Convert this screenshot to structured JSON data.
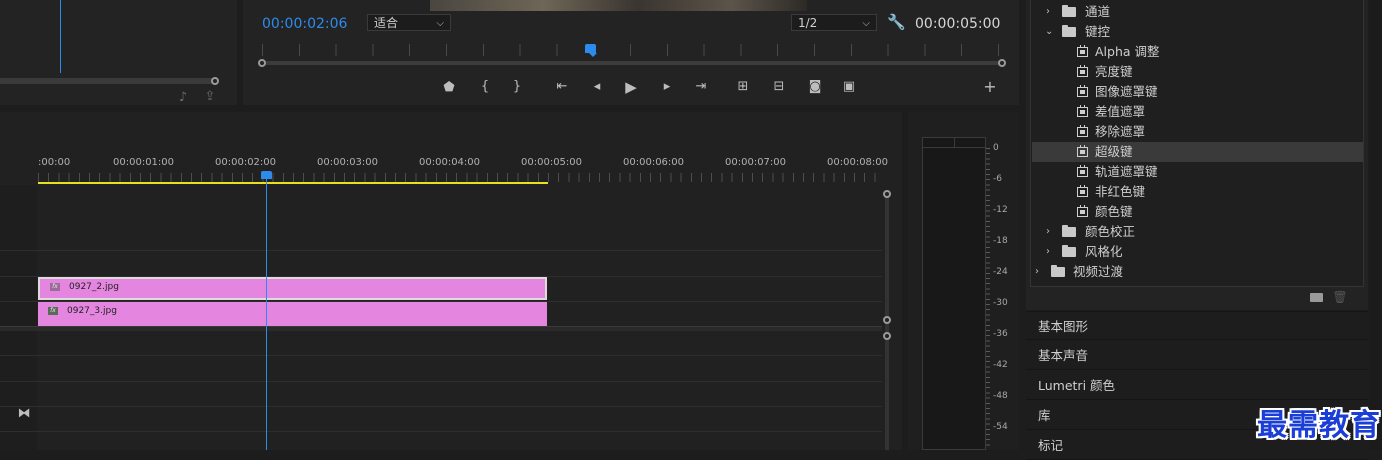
{
  "program_monitor": {
    "current_timecode": "00:00:02:06",
    "fit_select": "适合",
    "resolution_select": "1/2",
    "duration_timecode": "00:00:05:00"
  },
  "timeline": {
    "ruler_labels": [
      ":00:00",
      "00:00:01:00",
      "00:00:02:00",
      "00:00:03:00",
      "00:00:04:00",
      "00:00:05:00",
      "00:00:06:00",
      "00:00:07:00",
      "00:00:08:00"
    ],
    "clips": [
      {
        "name": "0927_2.jpg",
        "fx": "fx"
      },
      {
        "name": "0927_3.jpg",
        "fx": "fx"
      }
    ]
  },
  "audio_meter": {
    "db_labels": [
      "0",
      "-6",
      "-12",
      "-18",
      "-24",
      "-30",
      "-36",
      "-42",
      "-48",
      "-54"
    ]
  },
  "effects_tree": {
    "items": [
      {
        "label": "通道",
        "type": "folder",
        "expanded": false
      },
      {
        "label": "键控",
        "type": "folder",
        "expanded": true
      },
      {
        "label": "Alpha 调整",
        "type": "effect"
      },
      {
        "label": "亮度键",
        "type": "effect"
      },
      {
        "label": "图像遮罩键",
        "type": "effect"
      },
      {
        "label": "差值遮罩",
        "type": "effect"
      },
      {
        "label": "移除遮罩",
        "type": "effect"
      },
      {
        "label": "超级键",
        "type": "effect",
        "selected": true
      },
      {
        "label": "轨道遮罩键",
        "type": "effect"
      },
      {
        "label": "非红色键",
        "type": "effect"
      },
      {
        "label": "颜色键",
        "type": "effect"
      },
      {
        "label": "颜色校正",
        "type": "folder",
        "expanded": false
      },
      {
        "label": "风格化",
        "type": "folder",
        "expanded": false
      },
      {
        "label": "视频过渡",
        "type": "folder",
        "expanded": false
      }
    ]
  },
  "side_panels": [
    "基本图形",
    "基本声音",
    "Lumetri 颜色",
    "库",
    "标记"
  ],
  "watermark": "最需教育",
  "colors": {
    "accent_blue": "#2d8ceb",
    "clip_pink": "#e486e0",
    "work_area_yellow": "#e6e01e"
  }
}
